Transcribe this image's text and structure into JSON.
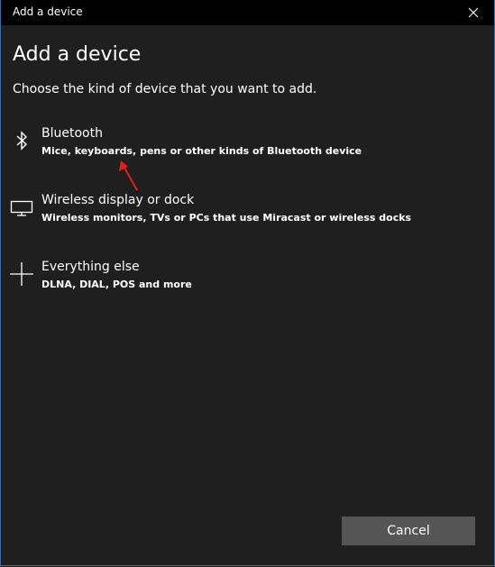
{
  "window": {
    "title": "Add a device"
  },
  "main": {
    "heading": "Add a device",
    "subheading": "Choose the kind of device that you want to add."
  },
  "options": [
    {
      "title": "Bluetooth",
      "description": "Mice, keyboards, pens or other kinds of Bluetooth device",
      "icon": "bluetooth-icon"
    },
    {
      "title": "Wireless display or dock",
      "description": "Wireless monitors, TVs or PCs that use Miracast or wireless docks",
      "icon": "monitor-icon"
    },
    {
      "title": "Everything else",
      "description": "DLNA, DIAL, POS and more",
      "icon": "plus-icon"
    }
  ],
  "footer": {
    "cancel_label": "Cancel"
  },
  "colors": {
    "background": "#1f1f1f",
    "titlebar": "#000000",
    "button": "#555555",
    "annotation_arrow": "#e0201a"
  }
}
